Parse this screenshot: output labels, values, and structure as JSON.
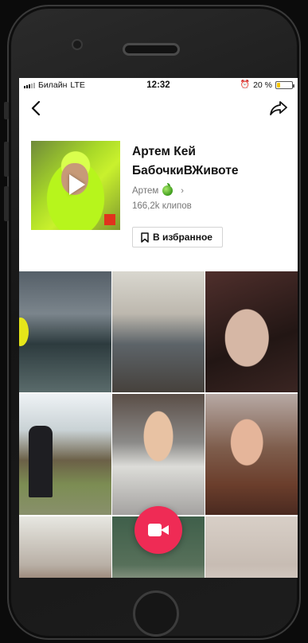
{
  "status": {
    "carrier": "Билайн",
    "network": "LTE",
    "time": "12:32",
    "battery": "20 %",
    "battery_level": 0.2
  },
  "nav": {
    "back_icon": "back-chevron-icon",
    "share_icon": "share-arrow-icon"
  },
  "sound": {
    "title_line1": "Артем Кей",
    "title_line2": "БабочкиВЖивоте",
    "author": "Артем",
    "author_emoji": "green-apple-icon",
    "clips": "166,2k клипов",
    "favorite_label": "В избранное"
  },
  "grid": {
    "tiles": [
      "video-1",
      "video-2",
      "video-3",
      "video-4",
      "video-5",
      "video-6",
      "video-7",
      "video-8",
      "video-9"
    ]
  },
  "colors": {
    "accent": "#ef2b55",
    "battery": "#f4c400"
  }
}
